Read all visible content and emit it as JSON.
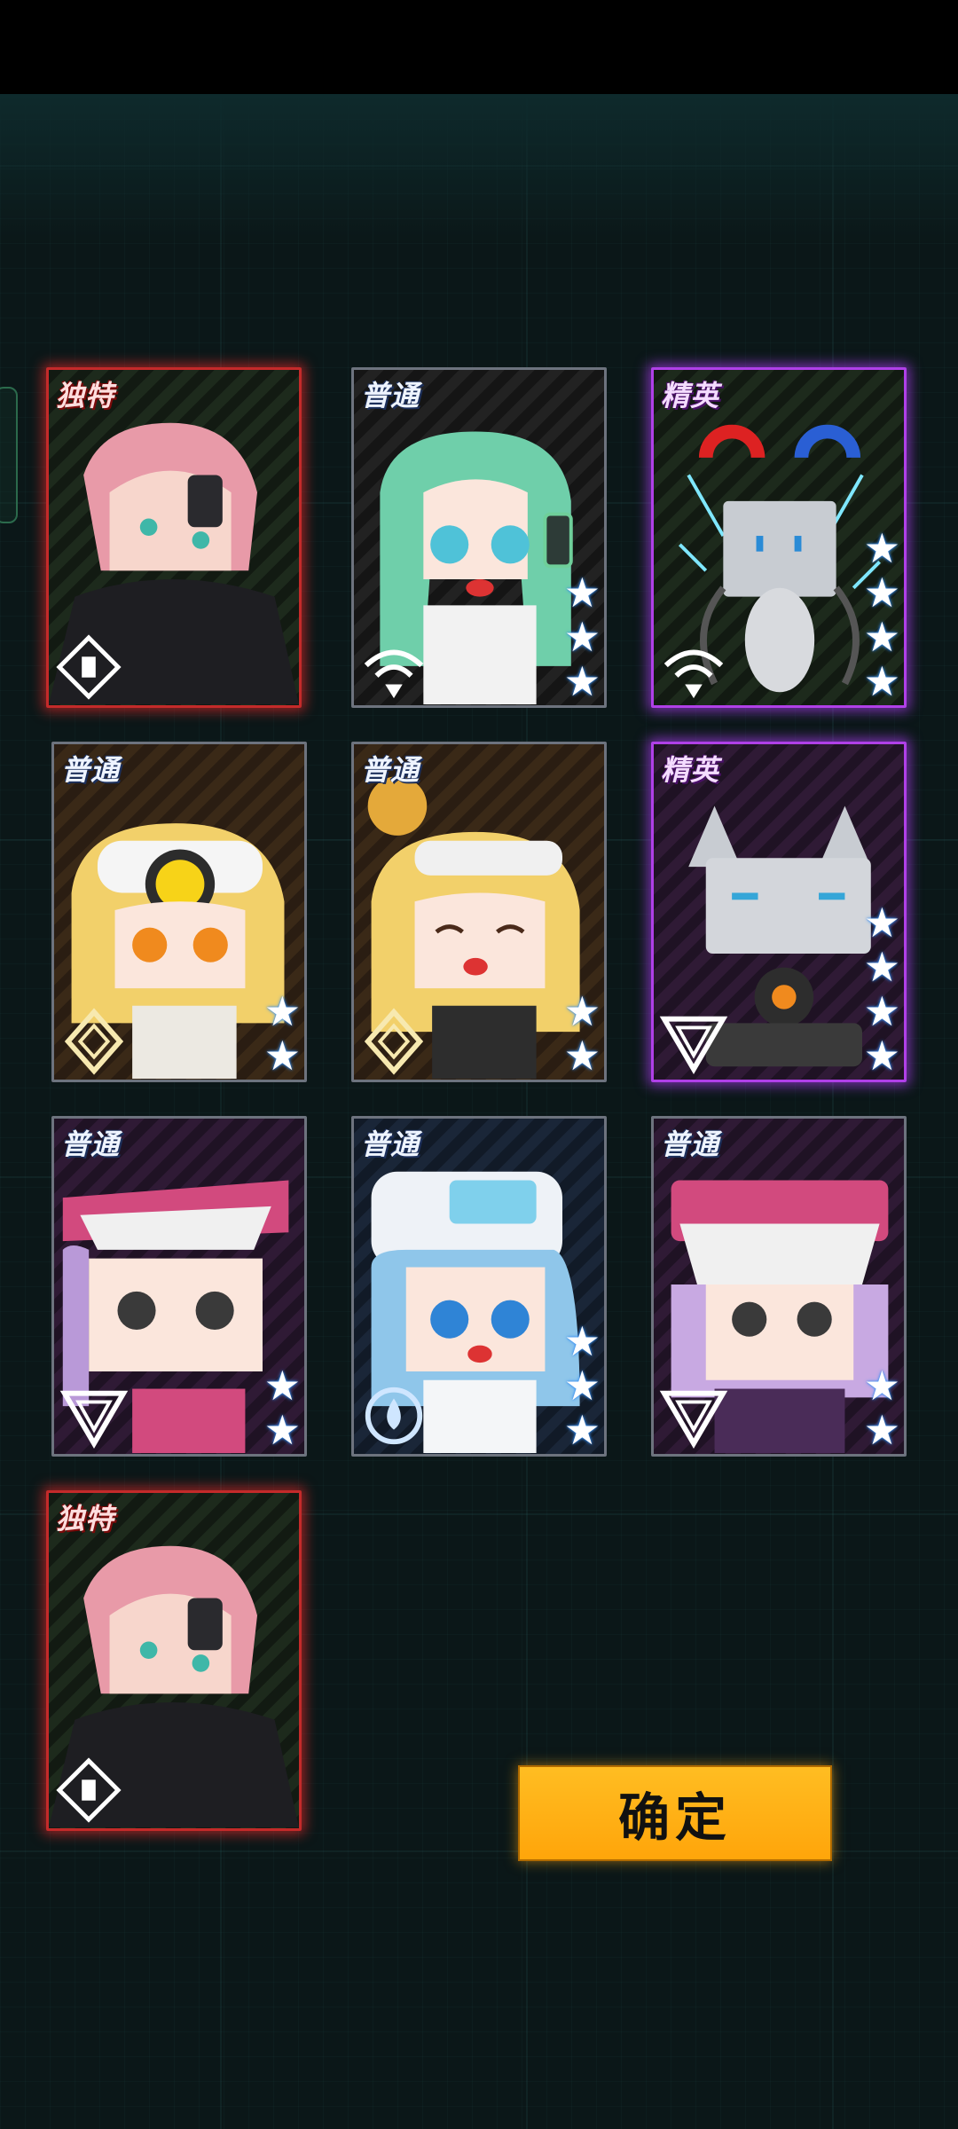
{
  "cards": [
    {
      "rarity": "独特",
      "stars": 0,
      "class_icon": "diamond-cross-icon",
      "character": "pink-hair-girl",
      "frame_color": "#c42a2a"
    },
    {
      "rarity": "普通",
      "stars": 3,
      "class_icon": "wifi-icon",
      "character": "green-hair-girl",
      "frame_color": "#6d737e"
    },
    {
      "rarity": "精英",
      "stars": 4,
      "class_icon": "wifi-icon",
      "character": "magnet-robot",
      "frame_color": "#b040e8"
    },
    {
      "rarity": "普通",
      "stars": 2,
      "class_icon": "diamond-icon",
      "character": "blonde-goggles-girl",
      "frame_color": "#6d737e"
    },
    {
      "rarity": "普通",
      "stars": 2,
      "class_icon": "diamond-icon",
      "character": "blonde-happy-girl",
      "frame_color": "#6d737e"
    },
    {
      "rarity": "精英",
      "stars": 4,
      "class_icon": "triangle-icon",
      "character": "cat-robot",
      "frame_color": "#b040e8"
    },
    {
      "rarity": "普通",
      "stars": 2,
      "class_icon": "triangle-icon",
      "character": "purple-hat-girl",
      "frame_color": "#6d737e"
    },
    {
      "rarity": "普通",
      "stars": 3,
      "class_icon": "circle-drop-icon",
      "character": "blue-hair-girl",
      "frame_color": "#6d737e"
    },
    {
      "rarity": "普通",
      "stars": 2,
      "class_icon": "triangle-icon",
      "character": "purple-helmet-girl",
      "frame_color": "#6d737e"
    },
    {
      "rarity": "独特",
      "stars": 0,
      "class_icon": "diamond-cross-icon",
      "character": "pink-hair-girl",
      "frame_color": "#c42a2a"
    }
  ],
  "confirm_button": {
    "label": "确定"
  }
}
